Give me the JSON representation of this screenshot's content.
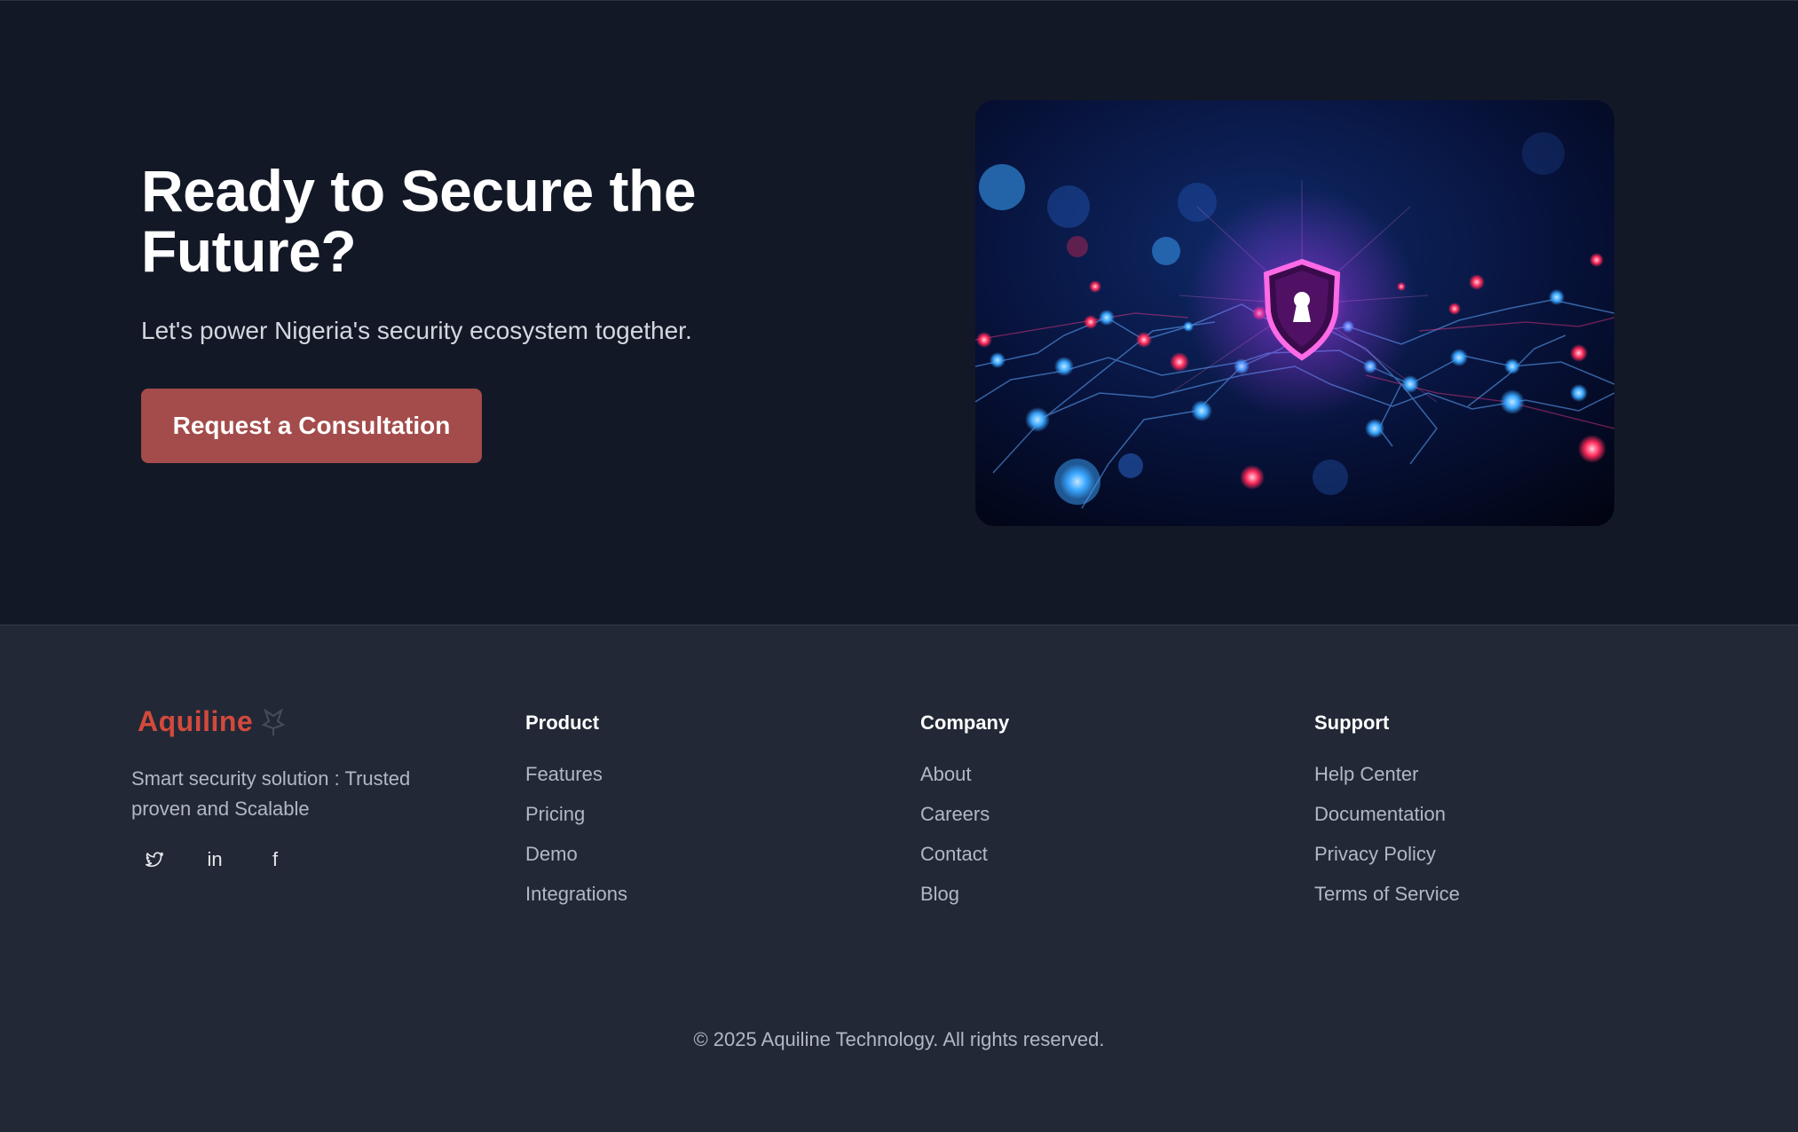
{
  "cta": {
    "title": "Ready to Secure the Future?",
    "subtitle": "Let's power Nigeria's security ecosystem together.",
    "button_label": "Request a Consultation",
    "image_icon": "shield-lock-network-illustration"
  },
  "footer": {
    "brand": {
      "name": "Aquiline",
      "icon": "bird-logo-icon",
      "tagline": "Smart security solution : Trusted proven and  Scalable"
    },
    "socials": [
      {
        "icon": "twitter-icon"
      },
      {
        "icon": "linkedin-icon",
        "label": "in"
      },
      {
        "icon": "facebook-icon",
        "label": "f"
      }
    ],
    "columns": {
      "product": {
        "title": "Product",
        "links": [
          "Features",
          "Pricing",
          "Demo",
          "Integrations"
        ]
      },
      "company": {
        "title": "Company",
        "links": [
          "About",
          "Careers",
          "Contact",
          "Blog"
        ]
      },
      "support": {
        "title": "Support",
        "links": [
          "Help Center",
          "Documentation",
          "Privacy Policy",
          "Terms of Service"
        ]
      }
    },
    "copyright": "© 2025 Aquiline Technology. All rights reserved."
  },
  "colors": {
    "background": "#131826",
    "footer_background": "#222836",
    "accent_button": "#a44b4b",
    "brand_red": "#d24a3c"
  }
}
